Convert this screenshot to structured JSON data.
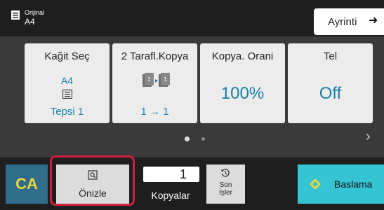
{
  "header": {
    "original_label": "Orijinal",
    "original_value": "A4",
    "detail_label": "Ayrinti",
    "detail_arrow": "➜"
  },
  "cards": {
    "paper": {
      "title": "Kağit Seç",
      "size": "A4",
      "tray": "Tepsi 1"
    },
    "duplex": {
      "title": "2 Tarafl.Kopya",
      "value": "1 → 1"
    },
    "ratio": {
      "title": "Kopya. Orani",
      "value": "100%"
    },
    "staple": {
      "title": "Tel",
      "value": "Off"
    }
  },
  "pager": {
    "pages": 2,
    "current": 1,
    "next_glyph": "›"
  },
  "footer": {
    "ca_label": "CA",
    "preview_label": "Önizle",
    "copies_value": "1",
    "copies_label": "Kopyalar",
    "jobs_label_line1": "Son",
    "jobs_label_line2": "İşler",
    "start_label": "Baslama"
  },
  "colors": {
    "accent_blue": "#1a7fa8",
    "start_cyan": "#35c4d3",
    "ca_blue": "#2f6d8a",
    "ca_yellow": "#e8d83a",
    "highlight_red": "#d0203b"
  },
  "icons": {
    "original": "original-document-icon",
    "tray": "paper-tray-icon",
    "duplex": "duplex-copy-icon",
    "preview": "preview-magnifier-icon",
    "jobs": "job-history-icon",
    "start": "start-diamond-icon"
  }
}
